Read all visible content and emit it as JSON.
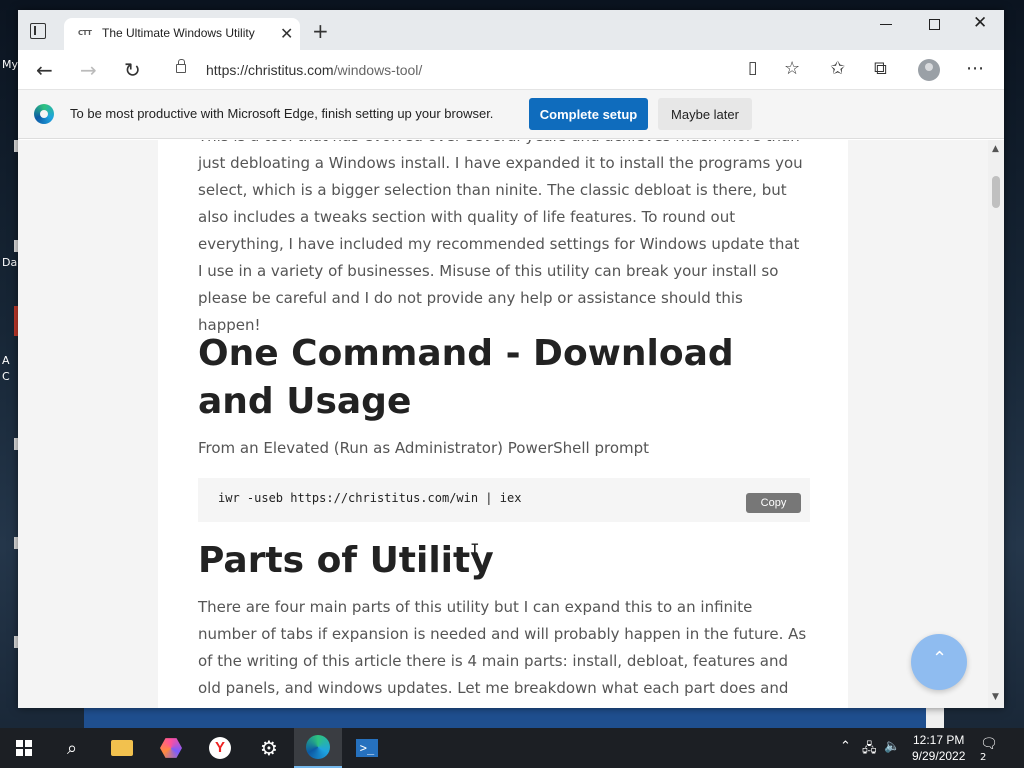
{
  "desktop": {
    "labels": [
      "My",
      "Da",
      "A",
      "C"
    ]
  },
  "browser": {
    "tab": {
      "favicon": "CTT",
      "title": "The Ultimate Windows Utility",
      "close": "✕"
    },
    "new_tab": "+",
    "window_controls": {
      "close": "✕"
    },
    "address": {
      "host": "https://christitus.com",
      "path": "/windows-tool/"
    },
    "infobar": {
      "text": "To be most productive with Microsoft Edge, finish setting up your browser.",
      "primary_label": "Complete setup",
      "secondary_label": "Maybe later"
    }
  },
  "article": {
    "intro": "This is a tool that has evolved over several years and achieves much more than just debloating a Windows install. I have expanded it to install the programs you select, which is a bigger selection than ninite. The classic debloat is there, but also includes a tweaks section with quality of life features. To round out everything, I have included my recommended settings for Windows update that I use in a variety of businesses. Misuse of this utility can break your install so please be careful and I do not provide any help or assistance should this happen!",
    "heading1": "One Command - Download and Usage",
    "prompt_note": "From an Elevated (Run as Administrator) PowerShell prompt",
    "code": "iwr -useb https://christitus.com/win | iex",
    "copy_label": "Copy",
    "heading2": "Parts of Utility",
    "parts_text": "There are four main parts of this utility but I can expand this to an infinite number of tabs if expansion is needed and will probably happen in the future. As of the writing of this article there is 4 main parts: install, debloat, features and old panels, and windows updates. Let me breakdown what each part does and what you should use."
  },
  "taskbar": {
    "time": "12:17 PM",
    "date": "9/29/2022",
    "notification_count": "2"
  },
  "colors": {
    "accent": "#0f6cbd",
    "scroll_top_button": "#8fbcf0",
    "taskbar": "#1c1f24"
  }
}
